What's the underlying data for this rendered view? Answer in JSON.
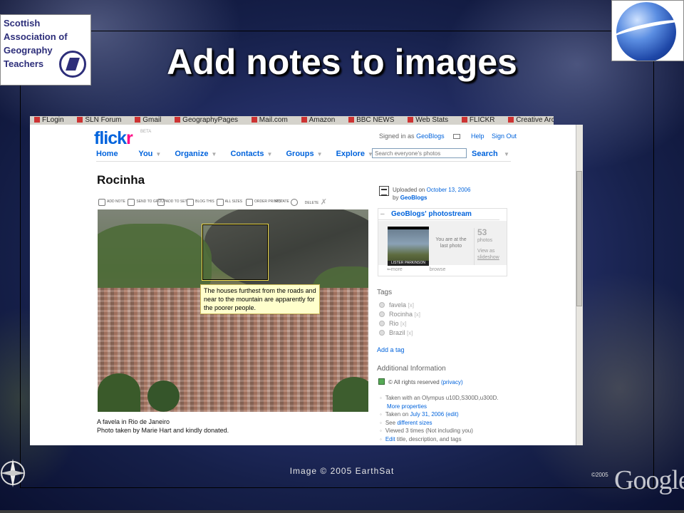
{
  "slide": {
    "title": "Add notes to images",
    "logo_left_lines": [
      "Scottish",
      "Association of",
      "Geography",
      "Teachers"
    ],
    "earthsat_credit": "Image © 2005 EarthSat",
    "bottom_copyright": "©2005",
    "watermark": "Google"
  },
  "bookmarks": [
    "FLogin",
    "SLN Forum",
    "Gmail",
    "GeographyPages",
    "Mail.com",
    "Amazon",
    "BBC NEWS",
    "Web Stats",
    "FLICKR",
    "Creative Archive Trial"
  ],
  "flickr": {
    "logo_a": "flick",
    "logo_b": "r",
    "beta": "BETA",
    "signed_in_text": "Signed in as",
    "user": "GeoBlogs",
    "help": "Help",
    "sign_out": "Sign Out",
    "nav": [
      "Home",
      "You",
      "Organize",
      "Contacts",
      "Groups",
      "Explore"
    ],
    "search_placeholder": "Search everyone's photos",
    "search_button": "Search"
  },
  "photo": {
    "title": "Rocinha",
    "toolbar": [
      {
        "icon": "add-note-icon",
        "label": "ADD NOTE"
      },
      {
        "icon": "send-to-group-icon",
        "label": "SEND TO GROUP"
      },
      {
        "icon": "add-to-set-icon",
        "label": "ADD TO SET"
      },
      {
        "icon": "blog-this-icon",
        "label": "BLOG THIS"
      },
      {
        "icon": "all-sizes-icon",
        "label": "ALL SIZES"
      },
      {
        "icon": "order-prints-icon",
        "label": "ORDER PRINTS"
      },
      {
        "icon": "rotate-icon",
        "label": "ROTATE"
      },
      {
        "icon": "delete-icon",
        "label": "DELETE"
      }
    ],
    "note": "The houses furthest from the roads and near to the mountain are apparently for the poorer people.",
    "caption_line1": "A favela in Rio de Janeiro",
    "caption_line2": "Photo taken by Marie Hart and kindly donated."
  },
  "sidebar": {
    "uploaded_on": "Uploaded on",
    "upload_date": "October 13, 2006",
    "by": "by",
    "owner": "GeoBlogs",
    "stream_title": "GeoBlogs' photostream",
    "thumb_caption": "LISTER PARKINSON",
    "last_photo_text": "You are at the last photo",
    "photo_count": "53",
    "photos_word": "photos",
    "view_as": "View as",
    "slideshow": "slideshow",
    "more": "more",
    "browse": "browse",
    "tags_title": "Tags",
    "tags": [
      "favela",
      "Rocinha",
      "Rio",
      "Brazil"
    ],
    "tag_remove": "[x]",
    "add_tag": "Add a tag",
    "additional_title": "Additional Information",
    "rights": "© All rights reserved",
    "privacy": "(privacy)",
    "camera": "Taken with an Olympus u10D,S300D,u300D.",
    "more_properties": "More properties",
    "taken_on": "Taken on",
    "taken_date": "July 31, 2006",
    "edit": "(edit)",
    "see": "See",
    "different_sizes": "different sizes",
    "viewed": "Viewed 3 times",
    "not_including": "(Not including you)",
    "edit_link": "Edit",
    "edit_rest": "title, description, and tags"
  }
}
